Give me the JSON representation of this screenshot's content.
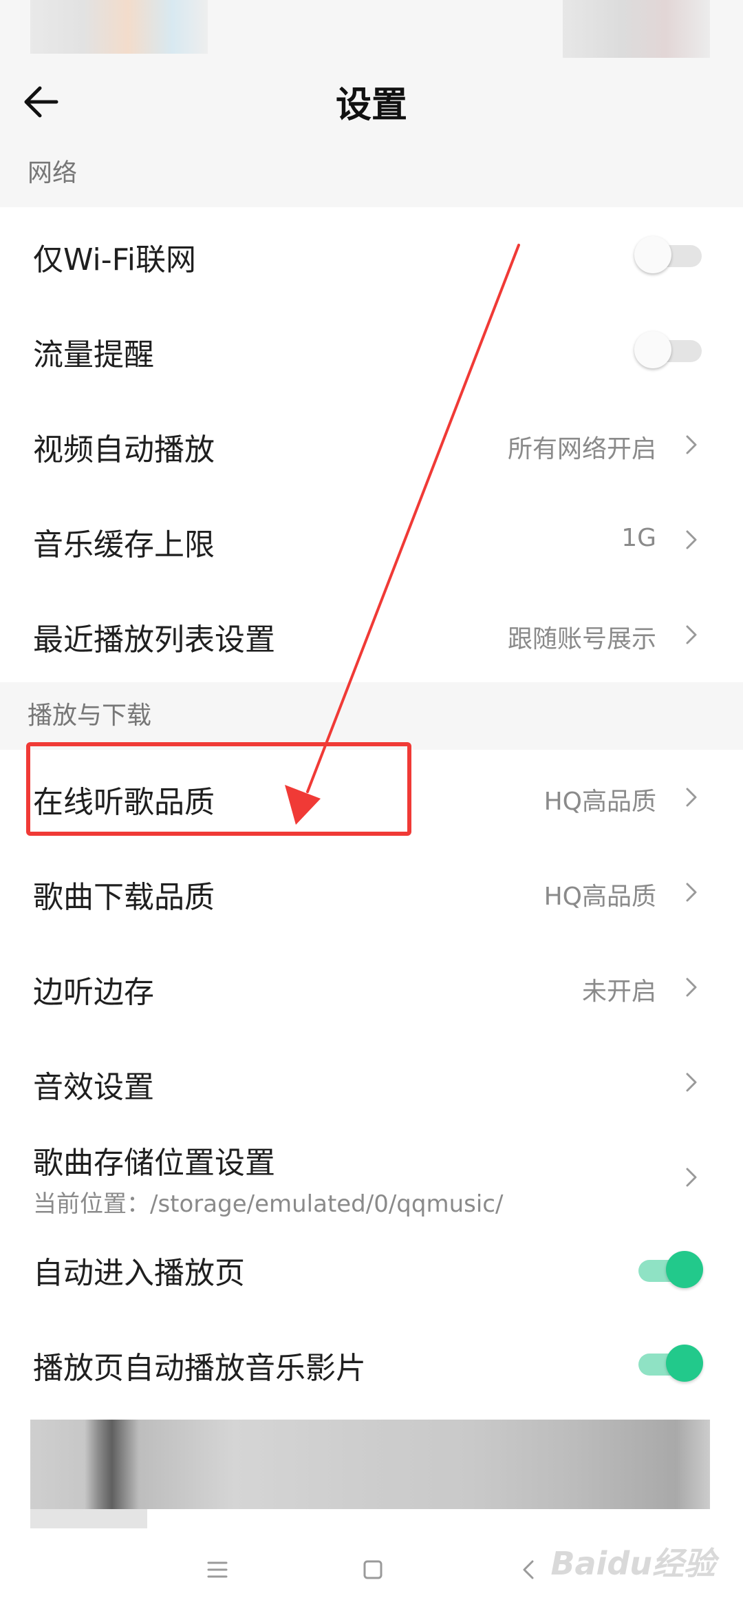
{
  "header": {
    "title": "设置"
  },
  "sections": {
    "network": {
      "label": "网络",
      "items": {
        "wifi_only": {
          "label": "仅Wi-Fi联网",
          "toggle": "off"
        },
        "data_alert": {
          "label": "流量提醒",
          "toggle": "off"
        },
        "video_autoplay": {
          "label": "视频自动播放",
          "value": "所有网络开启"
        },
        "cache_limit": {
          "label": "音乐缓存上限",
          "value": "1G"
        },
        "recent_list": {
          "label": "最近播放列表设置",
          "value": "跟随账号展示"
        }
      }
    },
    "playback": {
      "label": "播放与下载",
      "items": {
        "online_quality": {
          "label": "在线听歌品质",
          "value": "HQ高品质"
        },
        "download_quality": {
          "label": "歌曲下载品质",
          "value": "HQ高品质"
        },
        "listen_save": {
          "label": "边听边存",
          "value": "未开启"
        },
        "sound_effects": {
          "label": "音效设置"
        },
        "storage_location": {
          "label": "歌曲存储位置设置",
          "subtitle": "当前位置：/storage/emulated/0/qqmusic/"
        },
        "auto_player": {
          "label": "自动进入播放页",
          "toggle": "on"
        },
        "auto_mv": {
          "label": "播放页自动播放音乐影片",
          "toggle": "on"
        }
      }
    }
  },
  "annotation": {
    "color": "#f03a36"
  },
  "colors": {
    "accent": "#22c98b",
    "section_bg": "#f6f6f6"
  },
  "watermark": "Baidu经验"
}
